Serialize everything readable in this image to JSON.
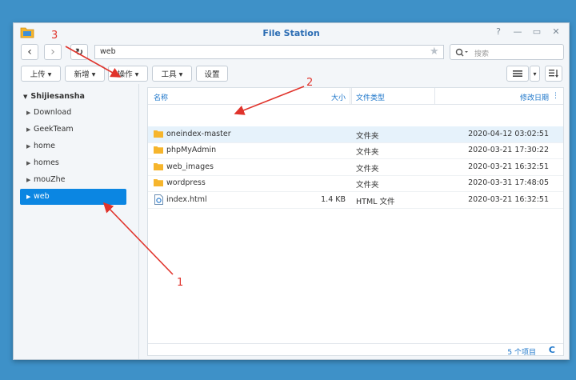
{
  "window": {
    "title": "File Station"
  },
  "titlebar": {
    "help": "?",
    "minimize": "—",
    "maximize": "▭",
    "close": "✕"
  },
  "nav": {
    "back": "‹",
    "forward": "›",
    "refresh": "↻"
  },
  "address": {
    "value": "web",
    "star": "★"
  },
  "search": {
    "placeholder": "搜索"
  },
  "toolbar": {
    "upload": "上传 ▾",
    "new": "新增 ▾",
    "action": "操作 ▾",
    "tools": "工具 ▾",
    "settings": "设置",
    "view_dropdown": "▾"
  },
  "sidebar": {
    "root": "Shijiesansha",
    "items": [
      {
        "label": "Download"
      },
      {
        "label": "GeekTeam"
      },
      {
        "label": "home"
      },
      {
        "label": "homes"
      },
      {
        "label": "mouZhe"
      },
      {
        "label": "web"
      }
    ]
  },
  "table": {
    "headers": {
      "name": "名称",
      "size": "大小",
      "type": "文件类型",
      "modified": "修改日期"
    },
    "rows": [
      {
        "name": "oneindex-master",
        "size": "",
        "type": "文件夹",
        "modified": "2020-04-12 03:02:51"
      },
      {
        "name": "phpMyAdmin",
        "size": "",
        "type": "文件夹",
        "modified": "2020-03-21 17:30:22"
      },
      {
        "name": "web_images",
        "size": "",
        "type": "文件夹",
        "modified": "2020-03-21 16:32:51"
      },
      {
        "name": "wordpress",
        "size": "",
        "type": "文件夹",
        "modified": "2020-03-31 17:48:05"
      },
      {
        "name": "index.html",
        "size": "1.4 KB",
        "type": "HTML 文件",
        "modified": "2020-03-21 16:32:51"
      }
    ]
  },
  "footer": {
    "count": "5 个项目",
    "refresh": "C"
  },
  "annotations": {
    "a1": "1",
    "a2": "2",
    "a3": "3"
  },
  "colors": {
    "accent": "#0b86e2",
    "annotation": "#e0332b",
    "folder": "#f6b52c"
  }
}
